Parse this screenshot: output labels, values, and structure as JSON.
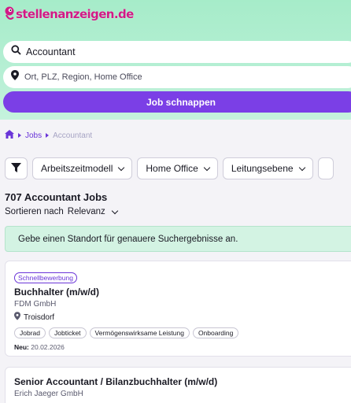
{
  "logo": {
    "text": "stellenanzeigen.de"
  },
  "search": {
    "what_value": "Accountant",
    "where_placeholder": "Ort, PLZ, Region, Home Office",
    "submit_label": "Job schnappen"
  },
  "breadcrumb": {
    "items": [
      "Jobs",
      "Accountant"
    ]
  },
  "filters": [
    "Arbeitszeitmodell",
    "Home Office",
    "Leitungsebene"
  ],
  "results": {
    "count_label": "707 Accountant Jobs",
    "sort_label": "Sortieren nach",
    "sort_value": "Relevanz"
  },
  "notice": "Gebe einen Standort für genauere Suchergebnisse an.",
  "jobs": [
    {
      "badge": "Schnellbewerbung",
      "title": "Buchhalter (m/w/d)",
      "company": "FDM GmbH",
      "location": "Troisdorf",
      "tags": [
        "Jobrad",
        "Jobticket",
        "Vermögenswirksame Leistung",
        "Onboarding"
      ],
      "date_label": "Neu:",
      "date_value": "20.02.2026"
    },
    {
      "title": "Senior Accountant / Bilanzbuchhalter (m/w/d)",
      "company": "Erich Jaeger GmbH"
    }
  ],
  "colors": {
    "accent": "#7b3fe6",
    "header_bg": "#b6efd4",
    "notice_bg": "#d3f3e3",
    "logo": "#d11a86"
  }
}
